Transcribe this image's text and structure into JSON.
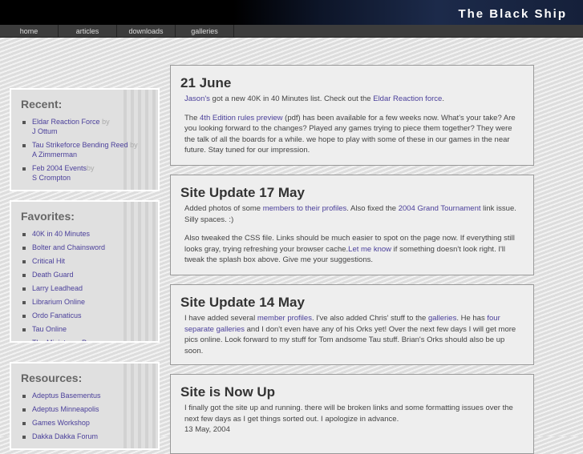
{
  "site_title": "The Black Ship",
  "nav": [
    "home",
    "articles",
    "downloads",
    "galleries"
  ],
  "recent": {
    "title": "Recent:",
    "items": [
      {
        "link": "Eldar Reaction Force",
        "by": "by",
        "author": "J Ottum"
      },
      {
        "link": "Tau Strikeforce Bending Reed",
        "by": "by",
        "author": "A Zimmerman"
      },
      {
        "link": "Feb 2004 Events",
        "by": "by",
        "author": "S Crompton"
      }
    ]
  },
  "favorites": {
    "title": "Favorites:",
    "items": [
      "40K in 40 Minutes",
      "Bolter and Chainsword",
      "Critical Hit",
      "Death Guard",
      "Larry Leadhead",
      "Librarium Online",
      "Ordo Fanaticus",
      "Tau Online",
      "The Miniatures Page"
    ]
  },
  "resources": {
    "title": "Resources:",
    "items": [
      "Adeptus Basementus",
      "Adeptus Minneapolis",
      "Games Workshop",
      "Dakka Dakka Forum"
    ]
  },
  "posts": [
    {
      "title": "21 June",
      "p1": {
        "a1": "Jason's",
        "t1": " got a new 40K in 40 Minutes list. Check out the ",
        "a2": "Eldar Reaction force",
        "t2": "."
      },
      "p2": {
        "t0": "The ",
        "a1": "4th Edition rules preview",
        "t1": " (pdf) has been available for a few weeks now. What's your take? Are you looking forward to the changes? Played any games trying to piece them together? They were the talk of all the boards for a while. we hope to play with some of these in our games in the near future. Stay tuned for our impression."
      }
    },
    {
      "title": "Site Update 17 May",
      "p1": {
        "t0": "Added photos of some ",
        "a1": "members to their profiles",
        "t1": ". Also fixed the ",
        "a2": "2004 Grand Tournament",
        "t2": " link issue. Silly spaces. :)"
      },
      "p2": {
        "t0": "Also tweaked the CSS file. Links should be much easier to spot on the page now. If everything still looks gray, trying refreshing your browser cache.",
        "a1": "Let me know",
        "t1": " if something doesn't look right. I'll tweak the splash box above. Give me your suggestions."
      }
    },
    {
      "title": "Site Update 14 May",
      "p1": {
        "t0": "I have added several ",
        "a1": "member profiles",
        "t1": ". I've also added Chris' stuff to the ",
        "a2": "galleries",
        "t2": ". He has ",
        "a3": "four separate galleries",
        "t3": " and I don't even have any of his Orks yet! Over the next few days I will get more pics online. Look forward to my stuff for Tom andsome Tau stuff. Brian's Orks should also be up soon."
      }
    },
    {
      "title": "Site is Now Up",
      "p1": {
        "t0": "I finally got the site up and running. there will be broken links and some formatting issues over the next few days as I get things sorted out. I apologize in advance."
      },
      "date": "13 May, 2004"
    }
  ]
}
